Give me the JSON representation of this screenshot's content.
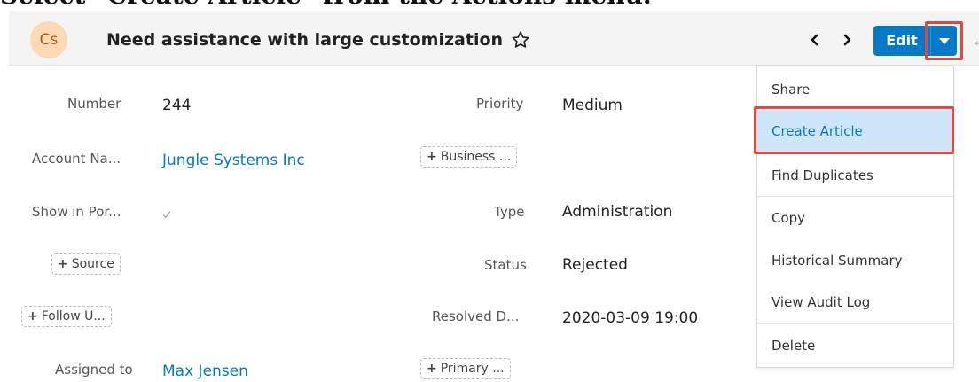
{
  "instruction": "Select \"Create Article\" from the Actions menu.",
  "header": {
    "avatar_text": "Cs",
    "title": "Need assistance with large customization",
    "edit_label": "Edit"
  },
  "fields": {
    "number": {
      "label": "Number",
      "value": "244"
    },
    "account_name": {
      "label": "Account Na...",
      "value": "Jungle Systems Inc"
    },
    "show_in_portal": {
      "label": "Show in Por..."
    },
    "source_pill": "Source",
    "follow_up_pill": "Follow U...",
    "assigned_to": {
      "label": "Assigned to",
      "value": "Max Jensen"
    },
    "priority": {
      "label": "Priority",
      "value": "Medium"
    },
    "business_pill": "Business ...",
    "type": {
      "label": "Type",
      "value": "Administration"
    },
    "status": {
      "label": "Status",
      "value": "Rejected"
    },
    "resolved": {
      "label": "Resolved D...",
      "value": "2020-03-09 19:00"
    },
    "primary_pill": "Primary ..."
  },
  "actions_menu": {
    "items": [
      "Share",
      "Create Article",
      "Find Duplicates",
      "Copy",
      "Historical Summary",
      "View Audit Log",
      "Delete"
    ],
    "selected": "Create Article"
  },
  "colors": {
    "accent": "#0679c8",
    "highlight_border": "#e04a3a",
    "menu_selected_bg": "#cfe6fa",
    "avatar_bg": "#fdd9b5"
  }
}
